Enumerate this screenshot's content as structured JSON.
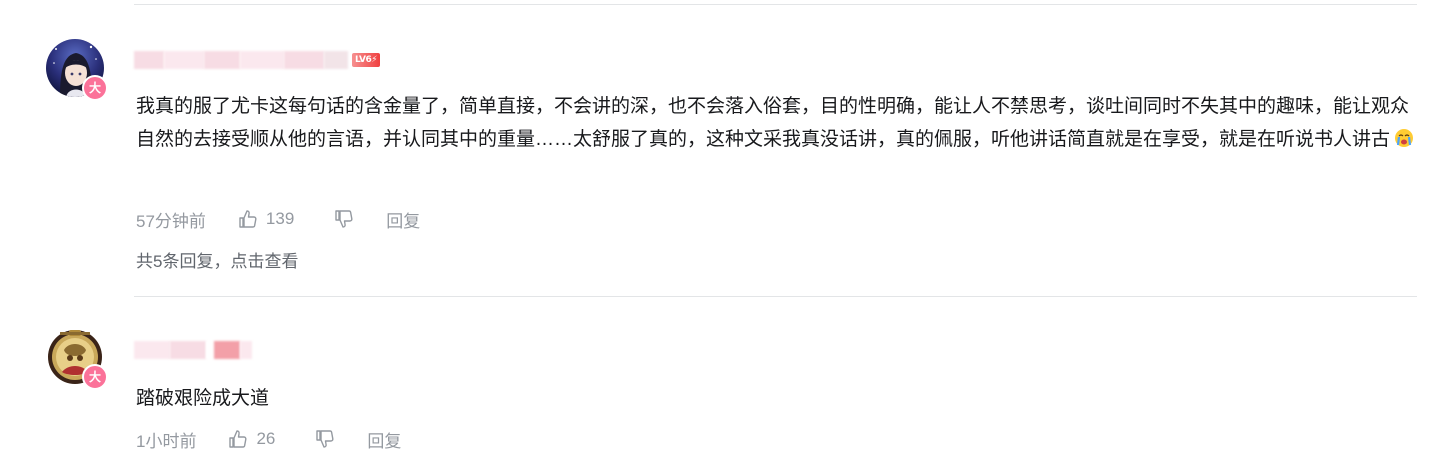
{
  "comments": [
    {
      "avatar_icon": "anime-avatar-icon",
      "vip_badge": "大",
      "level_badge": "6",
      "text": "我真的服了尤卡这每句话的含金量了，简单直接，不会讲的深，也不会落入俗套，目的性明确，能让人不禁思考，谈吐间同时不失其中的趣味，能让观众自然的去接受顺从他的言语，并认同其中的重量……太舒服了真的，这种文采我真没话讲，真的佩服，听他讲话简直就是在享受，就是在听说书人讲古",
      "emoji": "crying-face-emoji",
      "time": "57分钟前",
      "likes": "139",
      "reply_label": "回复",
      "view_replies": "共5条回复，点击查看"
    },
    {
      "avatar_icon": "medallion-avatar-icon",
      "vip_badge": "大",
      "text": "踏破艰险成大道",
      "time": "1小时前",
      "likes": "26",
      "reply_label": "回复"
    }
  ],
  "colors": {
    "text_primary": "#18191c",
    "text_meta": "#9499a0",
    "text_link": "#61666d",
    "vip_pink": "#fb7299",
    "divider": "#e3e5e7"
  }
}
